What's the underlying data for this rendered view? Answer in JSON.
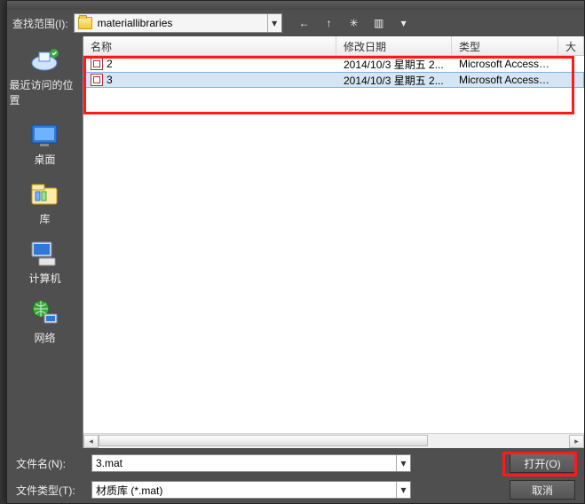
{
  "lookin_label": "查找范围(I):",
  "path": {
    "value": "materiallibraries"
  },
  "toolbar": {
    "back": "←",
    "up": "↑",
    "newfolder": "✳",
    "views": "▥"
  },
  "places": [
    {
      "key": "recent",
      "label": "最近访问的位置"
    },
    {
      "key": "desktop",
      "label": "桌面"
    },
    {
      "key": "library",
      "label": "库"
    },
    {
      "key": "computer",
      "label": "计算机"
    },
    {
      "key": "network",
      "label": "网络"
    }
  ],
  "columns": {
    "name": "名称",
    "date": "修改日期",
    "type": "类型",
    "size": "大"
  },
  "files": [
    {
      "name": "2",
      "date": "2014/10/3 星期五 2...",
      "type": "Microsoft Access T...",
      "selected": false
    },
    {
      "name": "3",
      "date": "2014/10/3 星期五 2...",
      "type": "Microsoft Access T...",
      "selected": true
    }
  ],
  "filenameLabel": "文件名(N):",
  "filetypeLabel": "文件类型(T):",
  "filenameValue": "3.mat",
  "filetypeValue": "材质库 (*.mat)",
  "openLabel": "打开(O)",
  "cancelLabel": "取消"
}
